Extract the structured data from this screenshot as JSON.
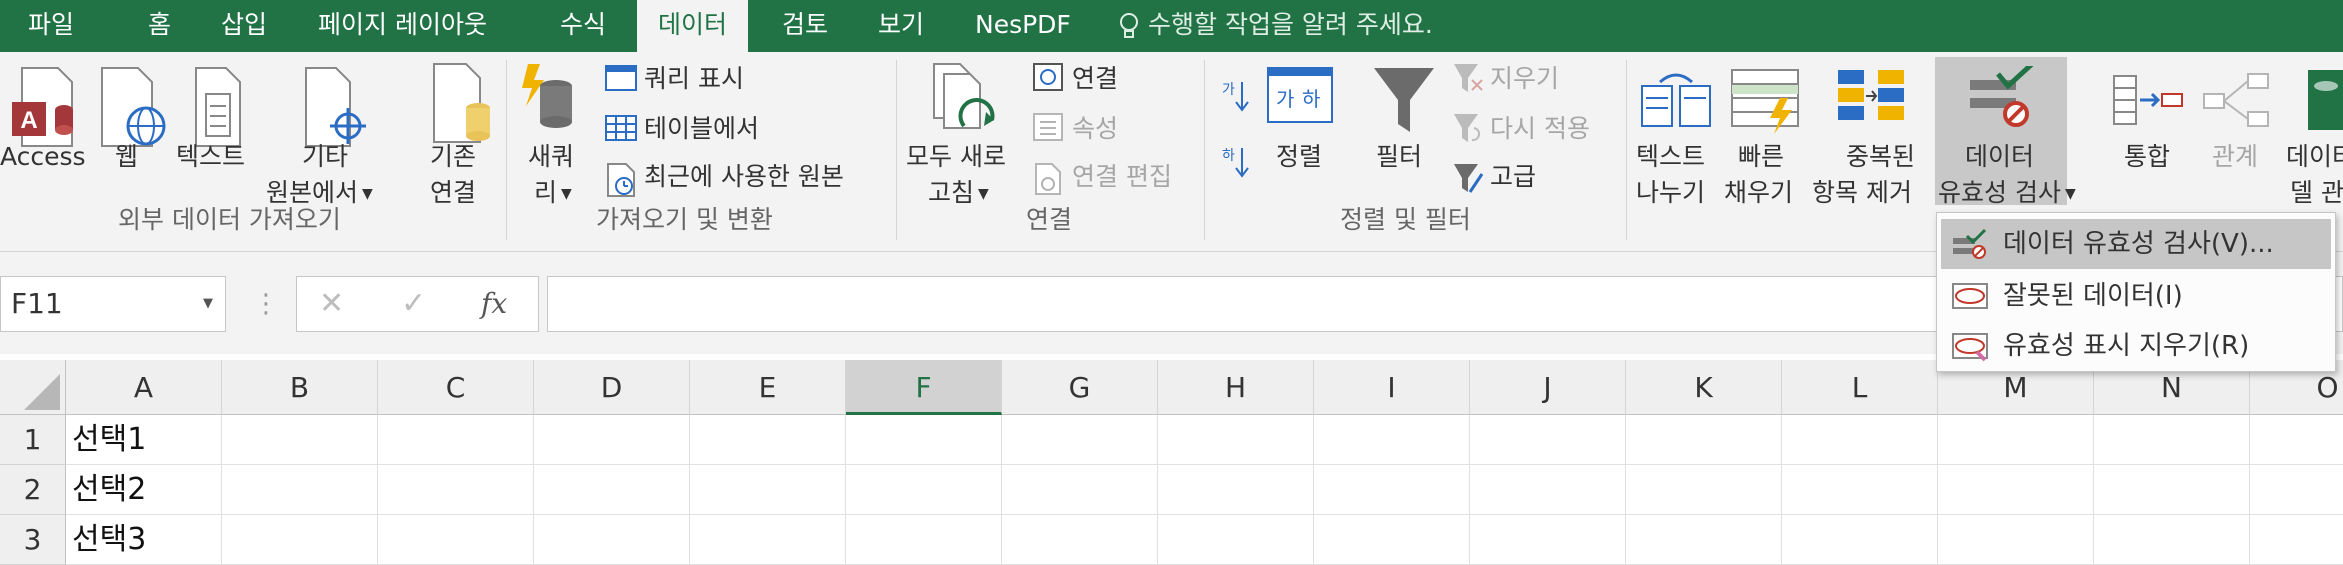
{
  "tabs": [
    "파일",
    "홈",
    "삽입",
    "페이지 레이아웃",
    "수식",
    "데이터",
    "검토",
    "보기",
    "NesPDF"
  ],
  "active_tab": "데이터",
  "tell_me": "수행할 작업을 알려 주세요.",
  "ribbon": {
    "external": {
      "access": "Access",
      "web": "웹",
      "text": "텍스트",
      "other_1": "기타",
      "other_2": "원본에서",
      "existing_1": "기존",
      "existing_2": "연결",
      "group": "외부 데이터 가져오기"
    },
    "transform": {
      "newquery_1": "새쿼",
      "newquery_2": "리",
      "show_queries": "쿼리 표시",
      "from_table": "테이블에서",
      "recent_sources": "최근에 사용한 원본",
      "group": "가져오기 및 변환"
    },
    "connections": {
      "refresh_1": "모두 새로",
      "refresh_2": "고침",
      "connections": "연결",
      "properties": "속성",
      "edit_links": "연결 편집",
      "group": "연결"
    },
    "sortfilter": {
      "sort": "정렬",
      "filter": "필터",
      "clear": "지우기",
      "reapply": "다시 적용",
      "advanced": "고급",
      "group": "정렬 및 필터"
    },
    "tools": {
      "text_to_col_1": "텍스트",
      "text_to_col_2": "나누기",
      "flash_fill_1": "빠른",
      "flash_fill_2": "채우기",
      "remove_dup_1": "중복된",
      "remove_dup_2": "항목 제거",
      "validation_1": "데이터",
      "validation_2": "유효성 검사",
      "consolidate": "통합",
      "relationships": "관계",
      "data_model_1": "데이터",
      "data_model_2": "델 관"
    }
  },
  "formula_bar": {
    "name_box": "F11",
    "fx": "fx",
    "value": ""
  },
  "grid": {
    "columns": [
      "A",
      "B",
      "C",
      "D",
      "E",
      "F",
      "G",
      "H",
      "I",
      "J",
      "K",
      "L",
      "M",
      "N",
      "O"
    ],
    "selected_column": "F",
    "rows": [
      {
        "num": "1",
        "a": "선택1"
      },
      {
        "num": "2",
        "a": "선택2"
      },
      {
        "num": "3",
        "a": "선택3"
      }
    ]
  },
  "menu": {
    "items": [
      {
        "label": "데이터 유효성 검사(V)...",
        "highlighted": true
      },
      {
        "label": "잘못된 데이터(I)",
        "highlighted": false
      },
      {
        "label": "유효성 표시 지우기(R)",
        "highlighted": false
      }
    ]
  },
  "colors": {
    "brand": "#217346",
    "ribbon_bg": "#f3f3f3",
    "hover": "#c8c8c8",
    "access_red": "#a4373a",
    "icon_blue": "#2b6cc4"
  }
}
